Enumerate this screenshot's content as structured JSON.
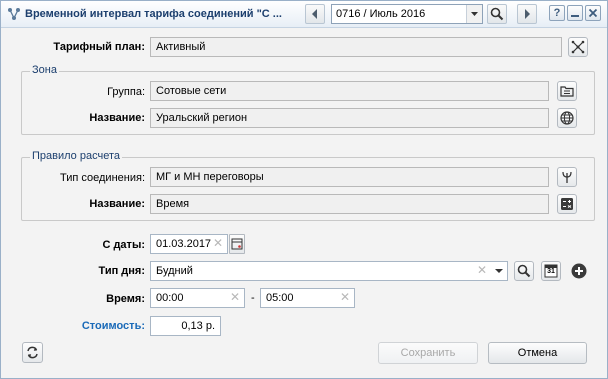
{
  "window": {
    "title": "Временной интервал тарифа соединений \"С ...",
    "period": "0716 / Июль 2016",
    "help_label": "?"
  },
  "form": {
    "tariff_plan": {
      "label": "Тарифный план:",
      "value": "Активный"
    },
    "zone": {
      "title": "Зона",
      "group_label": "Группа:",
      "group_value": "Сотовые сети",
      "name_label": "Название:",
      "name_value": "Уральский регион"
    },
    "rule": {
      "title": "Правило расчета",
      "conn_type_label": "Тип соединения:",
      "conn_type_value": "МГ и МН переговоры",
      "name_label": "Название:",
      "name_value": "Время"
    },
    "date_from": {
      "label": "С даты:",
      "value": "01.03.2017"
    },
    "day_type": {
      "label": "Тип дня:",
      "value": "Будний"
    },
    "time": {
      "label": "Время:",
      "from": "00:00",
      "separator": "-",
      "to": "05:00"
    },
    "cost": {
      "label": "Стоимость:",
      "value": "0,13 р."
    },
    "calendar_day": "31"
  },
  "footer": {
    "save_label": "Сохранить",
    "cancel_label": "Отмена"
  }
}
